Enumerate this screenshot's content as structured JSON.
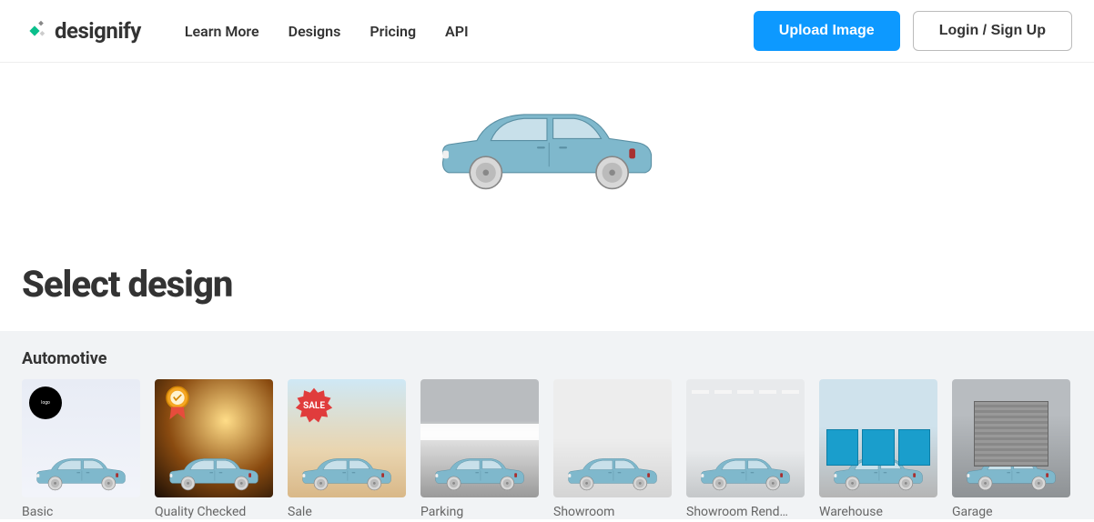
{
  "header": {
    "brand": "designify",
    "nav": {
      "learn_more": "Learn More",
      "designs": "Designs",
      "pricing": "Pricing",
      "api": "API"
    },
    "upload_label": "Upload Image",
    "login_label": "Login / Sign Up"
  },
  "section": {
    "title": "Select design"
  },
  "category": {
    "title": "Automotive",
    "items": [
      {
        "label": "Basic"
      },
      {
        "label": "Quality Checked"
      },
      {
        "label": "Sale"
      },
      {
        "label": "Parking"
      },
      {
        "label": "Showroom"
      },
      {
        "label": "Showroom Rend…"
      },
      {
        "label": "Warehouse"
      },
      {
        "label": "Garage"
      }
    ]
  },
  "badges": {
    "sale": "SALE"
  },
  "colors": {
    "primary": "#0d99ff",
    "car_body": "#7fb8cc"
  }
}
